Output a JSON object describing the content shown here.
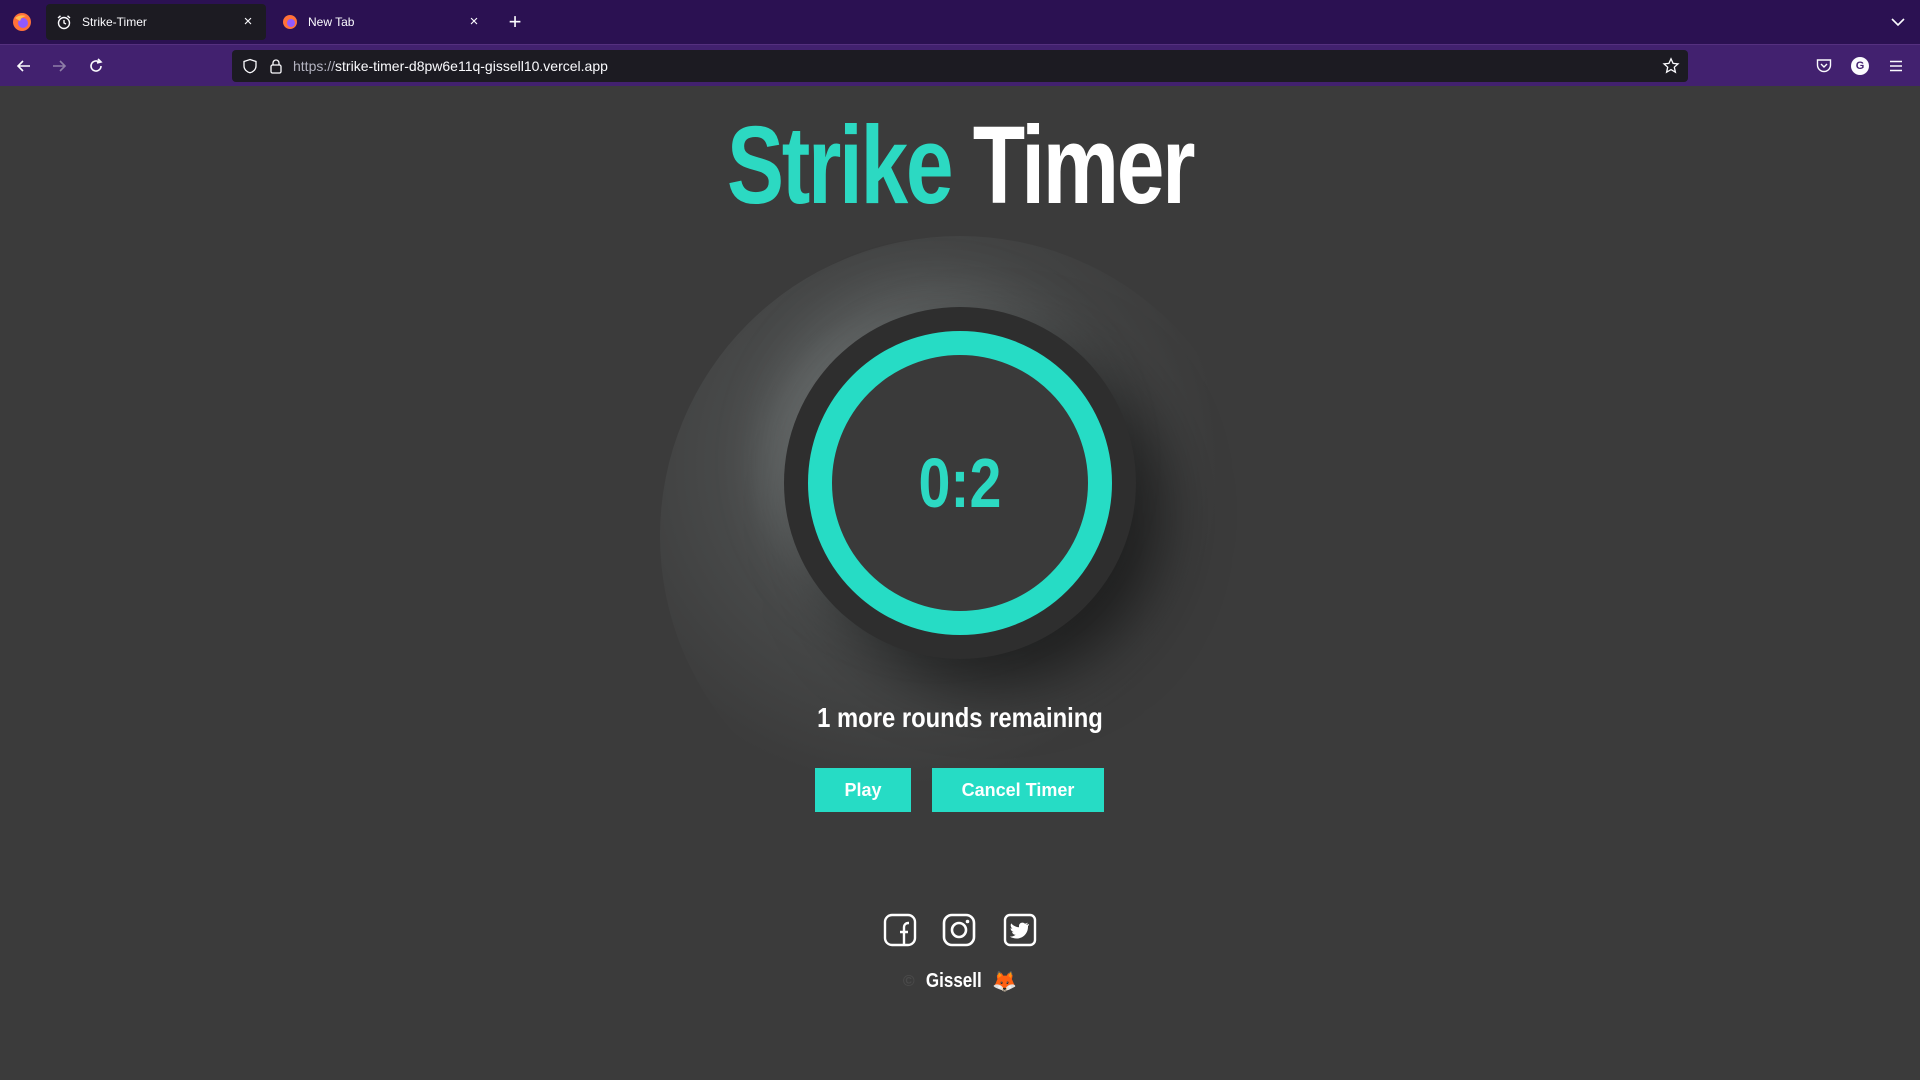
{
  "browser": {
    "tabs": [
      {
        "title": "Strike-Timer",
        "active": true,
        "icon": "alarm-clock-icon"
      },
      {
        "title": "New Tab",
        "active": false,
        "icon": "firefox-icon"
      }
    ],
    "url_protocol": "https://",
    "url_host": "strike-timer-d8pw6e11q-gissell10.vercel.app",
    "account_initial": "G"
  },
  "page": {
    "title_part1": "Strike",
    "title_part2": "Timer",
    "timer_value": "0:2",
    "rounds_text": "1 more rounds remaining",
    "play_label": "Play",
    "cancel_label": "Cancel Timer",
    "footer_copyright": "©",
    "footer_name": "Gissell",
    "footer_emoji": "🦊"
  },
  "colors": {
    "accent": "#2cd9c2",
    "background": "#3b3b3b",
    "tabbar": "#2b1152",
    "navbar": "#42216f"
  }
}
